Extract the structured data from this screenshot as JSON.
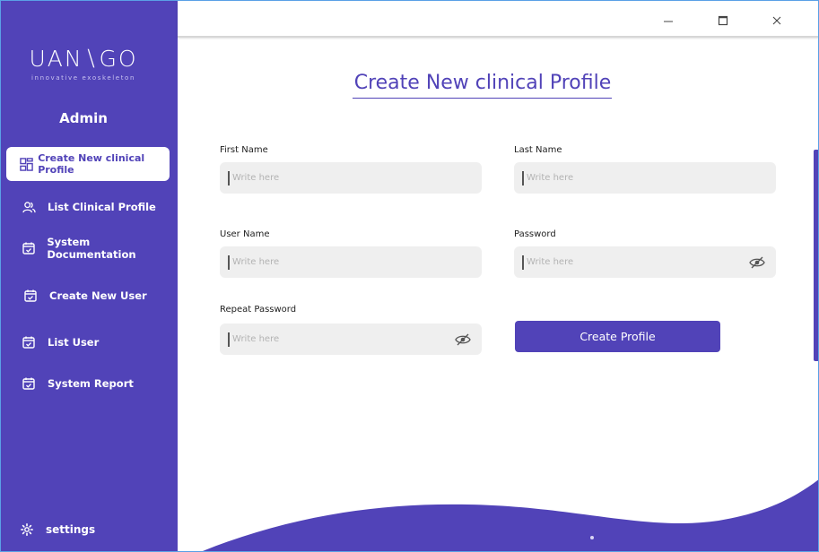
{
  "brand": {
    "logo_text": "UAN∖GO",
    "logo_tagline": "innovative exoskeleton"
  },
  "sidebar": {
    "role": "Admin",
    "items": [
      {
        "label": "Create New clinical Profile",
        "icon": "dashboard-grid-icon",
        "active": true
      },
      {
        "label": "List Clinical Profile",
        "icon": "users-icon",
        "active": false
      },
      {
        "label": "System Documentation",
        "icon": "calendar-check-icon",
        "active": false
      },
      {
        "label": "Create New User",
        "icon": "calendar-check-icon",
        "active": false
      },
      {
        "label": "List User",
        "icon": "calendar-check-icon",
        "active": false
      },
      {
        "label": "System Report",
        "icon": "calendar-check-icon",
        "active": false
      }
    ],
    "settings_label": "settings"
  },
  "window_controls": {
    "minimize": "minimize-icon",
    "maximize": "maximize-icon",
    "close": "close-icon"
  },
  "form": {
    "title": "Create New clinical Profile",
    "first_name": {
      "label": "First Name",
      "placeholder": "Write here",
      "value": ""
    },
    "last_name": {
      "label": "Last Name",
      "placeholder": "Write here",
      "value": ""
    },
    "user_name": {
      "label": "User Name",
      "placeholder": "Write here",
      "value": ""
    },
    "password": {
      "label": "Password",
      "placeholder": "Write here",
      "value": ""
    },
    "repeat_password": {
      "label": "Repeat Password",
      "placeholder": "Write here",
      "value": ""
    },
    "submit_label": "Create Profile"
  },
  "colors": {
    "brand": "#5143b8",
    "field_bg": "#efefef",
    "placeholder": "#b3b3b3"
  }
}
